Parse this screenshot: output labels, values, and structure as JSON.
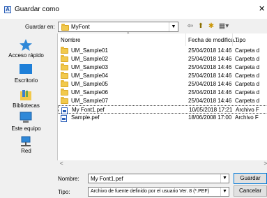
{
  "window": {
    "title": "Guardar como",
    "close_glyph": "✕",
    "app_icon_glyph": "A"
  },
  "location": {
    "label": "Guardar en:",
    "value": "MyFont",
    "arrow": "▼"
  },
  "toolbar_icons": [
    "back-icon",
    "up-folder-icon",
    "new-folder-icon",
    "view-menu-icon"
  ],
  "toolbar_glyphs": {
    "back": "⇦",
    "up": "⬆",
    "new_folder": "✱",
    "view": "▦▾"
  },
  "places": [
    {
      "label": "Acceso rápido",
      "icon": "star-icon"
    },
    {
      "label": "Escritorio",
      "icon": "desktop-icon"
    },
    {
      "label": "Bibliotecas",
      "icon": "libraries-icon"
    },
    {
      "label": "Este equipo",
      "icon": "computer-icon"
    },
    {
      "label": "Red",
      "icon": "network-icon"
    }
  ],
  "columns": {
    "name": "Nombre",
    "date": "Fecha de modifica...",
    "type": "Tipo",
    "sort_caret": "^"
  },
  "files": [
    {
      "name": "UM_Sample01",
      "date": "25/04/2018 14:46",
      "type": "Carpeta d",
      "icon": "folder-icon"
    },
    {
      "name": "UM_Sample02",
      "date": "25/04/2018 14:46",
      "type": "Carpeta d",
      "icon": "folder-icon"
    },
    {
      "name": "UM_Sample03",
      "date": "25/04/2018 14:46",
      "type": "Carpeta d",
      "icon": "folder-icon"
    },
    {
      "name": "UM_Sample04",
      "date": "25/04/2018 14:46",
      "type": "Carpeta d",
      "icon": "folder-icon"
    },
    {
      "name": "UM_Sample05",
      "date": "25/04/2018 14:46",
      "type": "Carpeta d",
      "icon": "folder-icon"
    },
    {
      "name": "UM_Sample06",
      "date": "25/04/2018 14:46",
      "type": "Carpeta d",
      "icon": "folder-icon"
    },
    {
      "name": "UM_Sample07",
      "date": "25/04/2018 14:46",
      "type": "Carpeta d",
      "icon": "folder-icon"
    },
    {
      "name": "My Font1.pef",
      "date": "10/05/2018 17:21",
      "type": "Archivo F",
      "icon": "font-file-icon"
    },
    {
      "name": "Sample.pef",
      "date": "18/06/2008 17:00",
      "type": "Archivo F",
      "icon": "font-file-icon"
    }
  ],
  "scroll": {
    "left": "<",
    "right": ">"
  },
  "filename": {
    "label": "Nombre:",
    "value": "My Font1.pef",
    "arrow": "▼"
  },
  "filetype": {
    "label": "Tipo:",
    "value": "Archivo de fuente definido por el usuario Ver. 8 (*.PEF)",
    "arrow": "▼"
  },
  "buttons": {
    "save": "Guardar",
    "cancel": "Cancelar"
  },
  "colors": {
    "accent": "#0078d7",
    "folder": "#f2c94c",
    "file": "#2b5fb8"
  }
}
